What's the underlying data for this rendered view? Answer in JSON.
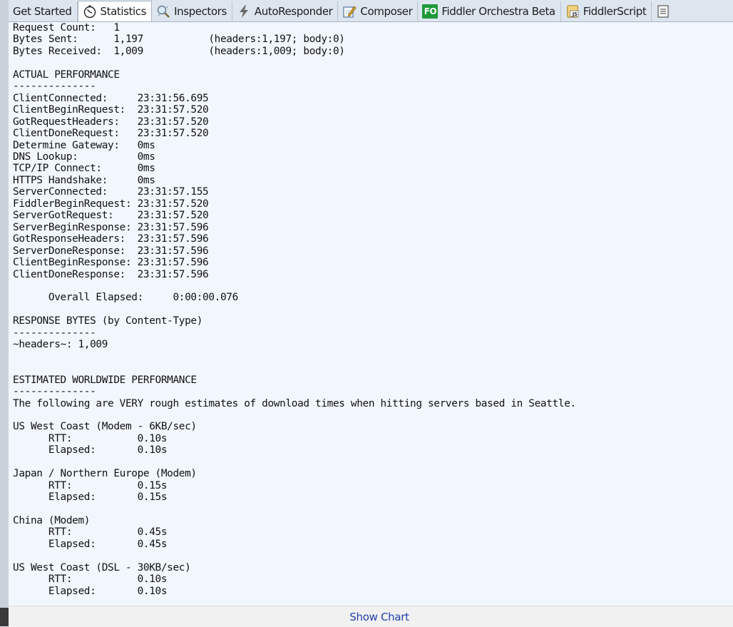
{
  "tabs": [
    {
      "label": "Get Started",
      "icon": "",
      "active": false
    },
    {
      "label": "Statistics",
      "icon": "stopwatch-icon",
      "active": true
    },
    {
      "label": "Inspectors",
      "icon": "magnifier-icon",
      "active": false
    },
    {
      "label": "AutoResponder",
      "icon": "lightning-icon",
      "active": false
    },
    {
      "label": "Composer",
      "icon": "compose-pencil-icon",
      "active": false
    },
    {
      "label": "Fiddler Orchestra Beta",
      "icon": "fo-badge-icon",
      "icon_text": "FO",
      "active": false
    },
    {
      "label": "FiddlerScript",
      "icon": "js-script-icon",
      "icon_text": "JS",
      "active": false
    },
    {
      "label": "",
      "icon": "log-list-icon",
      "active": false
    }
  ],
  "report_text": "Request Count:   1\nBytes Sent:      1,197           (headers:1,197; body:0)\nBytes Received:  1,009           (headers:1,009; body:0)\n\nACTUAL PERFORMANCE\n--------------\nClientConnected:     23:31:56.695\nClientBeginRequest:  23:31:57.520\nGotRequestHeaders:   23:31:57.520\nClientDoneRequest:   23:31:57.520\nDetermine Gateway:   0ms\nDNS Lookup:          0ms\nTCP/IP Connect:      0ms\nHTTPS Handshake:     0ms\nServerConnected:     23:31:57.155\nFiddlerBeginRequest: 23:31:57.520\nServerGotRequest:    23:31:57.520\nServerBeginResponse: 23:31:57.596\nGotResponseHeaders:  23:31:57.596\nServerDoneResponse:  23:31:57.596\nClientBeginResponse: 23:31:57.596\nClientDoneResponse:  23:31:57.596\n\n      Overall Elapsed:     0:00:00.076\n\nRESPONSE BYTES (by Content-Type)\n--------------\n~headers~: 1,009\n\n\nESTIMATED WORLDWIDE PERFORMANCE\n--------------\nThe following are VERY rough estimates of download times when hitting servers based in Seattle.\n\nUS West Coast (Modem - 6KB/sec)\n      RTT:           0.10s\n      Elapsed:       0.10s\n\nJapan / Northern Europe (Modem)\n      RTT:           0.15s\n      Elapsed:       0.15s\n\nChina (Modem)\n      RTT:           0.45s\n      Elapsed:       0.45s\n\nUS West Coast (DSL - 30KB/sec)\n      RTT:           0.10s\n      Elapsed:       0.10s",
  "footer": {
    "show_chart_label": "Show Chart"
  },
  "colors": {
    "content_background": "#f1f7fd",
    "link": "#2340b0",
    "fo_badge": "#1f9a3a"
  }
}
